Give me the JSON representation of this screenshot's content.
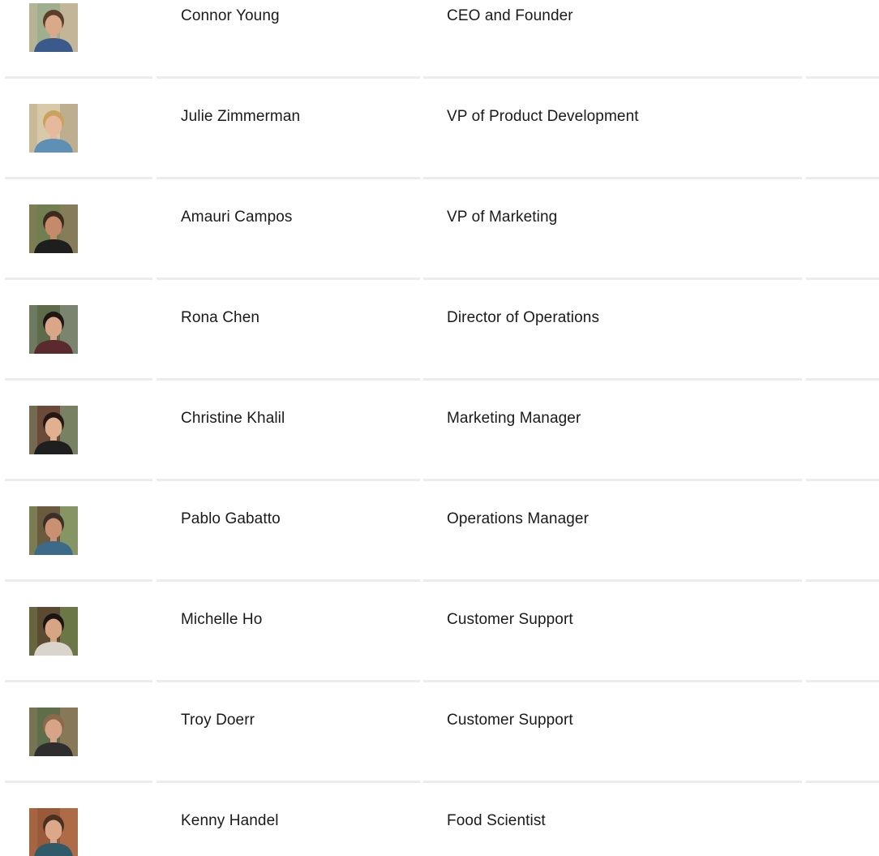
{
  "team": [
    {
      "name": "Connor Young",
      "role": "CEO and Founder",
      "photo": {
        "bg": "#9fae8c",
        "bg2": "#c9b79a",
        "skin": "#d9a98a",
        "hair": "#5a3d2b",
        "shirt": "#3a5a8c"
      }
    },
    {
      "name": "Julie Zimmerman",
      "role": "VP of Product Development",
      "photo": {
        "bg": "#d8c9a8",
        "bg2": "#b7a98a",
        "skin": "#e6b99c",
        "hair": "#c9a25f",
        "shirt": "#5f8fb5"
      }
    },
    {
      "name": "Amauri Campos",
      "role": "VP of Marketing",
      "photo": {
        "bg": "#6f7f4f",
        "bg2": "#8b7b5a",
        "skin": "#c48a6a",
        "hair": "#3a2a20",
        "shirt": "#1e1e1e"
      }
    },
    {
      "name": "Rona Chen",
      "role": "Director of Operations",
      "photo": {
        "bg": "#5d6b4a",
        "bg2": "#7f8a76",
        "skin": "#d9a688",
        "hair": "#1e1612",
        "shirt": "#5a2a2e"
      }
    },
    {
      "name": "Christine Khalil",
      "role": "Marketing Manager",
      "photo": {
        "bg": "#6b4a3a",
        "bg2": "#7a8c6a",
        "skin": "#e0b090",
        "hair": "#241812",
        "shirt": "#1f1f1f"
      }
    },
    {
      "name": "Pablo Gabatto",
      "role": "Operations Manager",
      "photo": {
        "bg": "#6a5a3e",
        "bg2": "#8aa06a",
        "skin": "#c99072",
        "hair": "#3a3028",
        "shirt": "#3e6a8a"
      }
    },
    {
      "name": "Michelle Ho",
      "role": "Customer Support",
      "photo": {
        "bg": "#5a4a32",
        "bg2": "#6f7f4a",
        "skin": "#d7a584",
        "hair": "#1c1410",
        "shirt": "#d9d4cc"
      }
    },
    {
      "name": "Troy Doerr",
      "role": "Customer Support",
      "photo": {
        "bg": "#5f6e4a",
        "bg2": "#8e7a5a",
        "skin": "#d8a488",
        "hair": "#8a6a4a",
        "shirt": "#2e2e2e"
      }
    },
    {
      "name": "Kenny Handel",
      "role": "Food Scientist",
      "photo": {
        "bg": "#9a5a3a",
        "bg2": "#b0704a",
        "skin": "#dca88a",
        "hair": "#4a3020",
        "shirt": "#2e5a6a"
      }
    }
  ]
}
